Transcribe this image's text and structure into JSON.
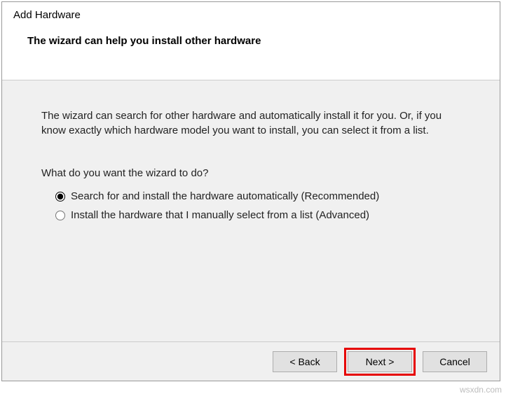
{
  "header": {
    "title": "Add Hardware",
    "subtitle": "The wizard can help you install other hardware"
  },
  "body": {
    "intro": "The wizard can search for other hardware and automatically install it for you. Or, if you know exactly which hardware model you want to install, you can select it from a list.",
    "prompt": "What do you want the wizard to do?",
    "options": [
      {
        "label": "Search for and install the hardware automatically (Recommended)",
        "checked": true
      },
      {
        "label": "Install the hardware that I manually select from a list (Advanced)",
        "checked": false
      }
    ]
  },
  "footer": {
    "back": "< Back",
    "next": "Next >",
    "cancel": "Cancel"
  },
  "watermark": "wsxdn.com"
}
